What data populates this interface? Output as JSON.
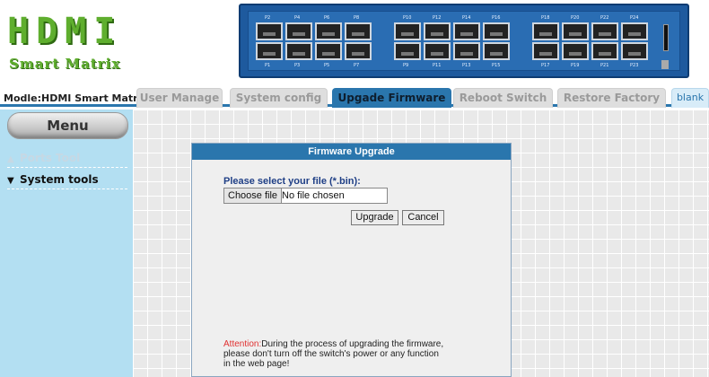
{
  "header": {
    "logo_main": "HDMI",
    "logo_sub": "Smart Matrix",
    "switch_ports_top": [
      "P2",
      "P4",
      "P6",
      "P8",
      "P10",
      "P12",
      "P14",
      "P16",
      "P18",
      "P20",
      "P22",
      "P24"
    ],
    "switch_ports_bottom": [
      "P1",
      "P3",
      "P5",
      "P7",
      "P9",
      "P11",
      "P13",
      "P15",
      "P17",
      "P19",
      "P21",
      "P23"
    ]
  },
  "model_label": "Modle:HDMI Smart Matrix",
  "tabs": [
    {
      "label": "User Manage"
    },
    {
      "label": "System config"
    },
    {
      "label": "Upgade Firmware"
    },
    {
      "label": "Reboot Switch"
    },
    {
      "label": "Restore Factory"
    },
    {
      "label": "blank"
    }
  ],
  "sidebar": {
    "menu_label": "Menu",
    "items": [
      {
        "label": "Ports Tool",
        "arrow": "▲"
      },
      {
        "label": "System tools",
        "arrow": "▼"
      }
    ]
  },
  "dialog": {
    "title": "Firmware Upgrade",
    "select_label": "Please select your file (*.bin):",
    "choose_button": "Choose file",
    "file_status": "No file chosen",
    "upgrade_button": "Upgrade",
    "cancel_button": "Cancel",
    "attention_label": "Attention:",
    "attention_text": "During the process of upgrading the firmware, please don't turn off the switch's power or any function in the web page!"
  },
  "colors": {
    "accent": "#2a76ad",
    "sidebar_bg": "#b3dff2",
    "logo_green": "#5fae2e",
    "attention_red": "#e03030"
  }
}
